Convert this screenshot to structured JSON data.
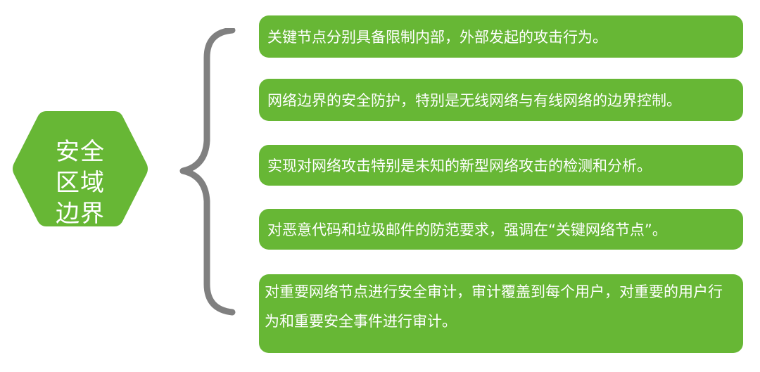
{
  "center": {
    "label": "安全区域边界",
    "color": "#67b735"
  },
  "brace_color": "#808080",
  "items": [
    {
      "text": "关键节点分别具备限制内部，外部发起的攻击行为。"
    },
    {
      "text": "网络边界的安全防护，特别是无线网络与有线网络的边界控制。"
    },
    {
      "text": "实现对网络攻击特别是未知的新型网络攻击的检测和分析。"
    },
    {
      "text": "对恶意代码和垃圾邮件的防范要求，强调在“关键网络节点”。"
    },
    {
      "text": " 对重要网络节点进行安全审计，审计覆盖到每个用户，对重要的用户行为和重要安全事件进行审计。"
    }
  ],
  "item_color": "#67b735"
}
